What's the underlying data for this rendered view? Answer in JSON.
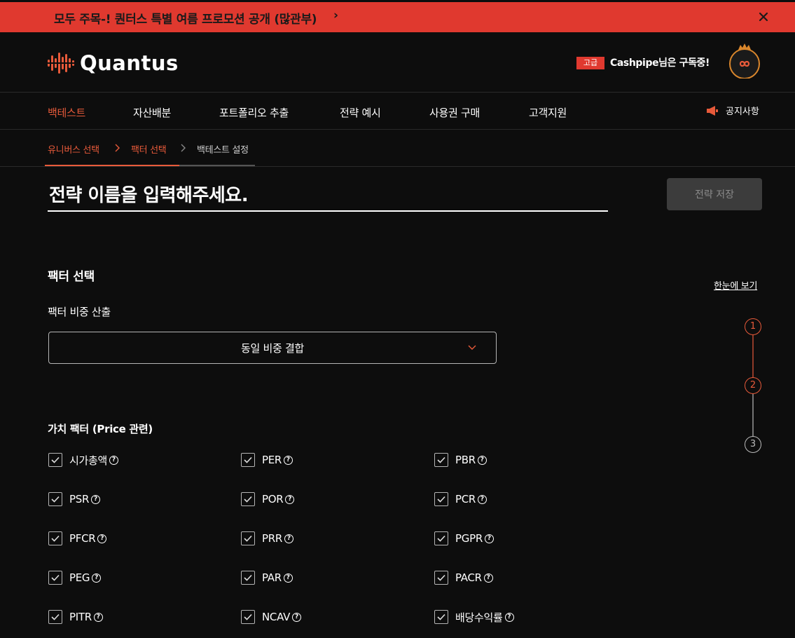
{
  "promo": {
    "text": "모두 주목-! 퀀터스 특별 여름 프로모션 공개 (많관부)",
    "chevron": "›"
  },
  "brand": {
    "name": "Quantus",
    "accent": "#e85a3a",
    "banner_color": "#e0392f"
  },
  "user": {
    "tier": "고급",
    "subscription": "Cashpipe님은 구독중!",
    "avatar_glyph": "∞"
  },
  "nav": {
    "items": [
      {
        "label": "백테스트",
        "active": true
      },
      {
        "label": "자산배분",
        "active": false
      },
      {
        "label": "포트폴리오 추출",
        "active": false
      },
      {
        "label": "전략 예시",
        "active": false
      },
      {
        "label": "사용권 구매",
        "active": false
      },
      {
        "label": "고객지원",
        "active": false
      }
    ],
    "notice": "공지사항"
  },
  "breadcrumb": {
    "steps": [
      {
        "label": "유니버스 선택",
        "state": "done"
      },
      {
        "label": "팩터 선택",
        "state": "done"
      },
      {
        "label": "백테스트 설정",
        "state": "current"
      }
    ],
    "separator": ">"
  },
  "strategy": {
    "name_placeholder": "전략 이름을 입력해주세요.",
    "save_label": "전략 저장"
  },
  "factor_section": {
    "title": "팩터 선택",
    "overview_link": "한눈에 보기",
    "weight_label": "팩터 비중 산출",
    "weight_value": "동일 비중 결합",
    "steps": [
      "1",
      "2",
      "3"
    ],
    "groups": [
      {
        "title": "가치 팩터 (Price 관련)",
        "help_glyph": "?",
        "factors": [
          {
            "label": "시가총액",
            "checked": true
          },
          {
            "label": "PER",
            "checked": true
          },
          {
            "label": "PBR",
            "checked": true
          },
          {
            "label": "PSR",
            "checked": true
          },
          {
            "label": "POR",
            "checked": true
          },
          {
            "label": "PCR",
            "checked": true
          },
          {
            "label": "PFCR",
            "checked": true
          },
          {
            "label": "PRR",
            "checked": true
          },
          {
            "label": "PGPR",
            "checked": true
          },
          {
            "label": "PEG",
            "checked": true
          },
          {
            "label": "PAR",
            "checked": true
          },
          {
            "label": "PACR",
            "checked": true
          },
          {
            "label": "PITR",
            "checked": true
          },
          {
            "label": "NCAV",
            "checked": true
          },
          {
            "label": "배당수익률",
            "checked": true
          }
        ]
      }
    ]
  }
}
